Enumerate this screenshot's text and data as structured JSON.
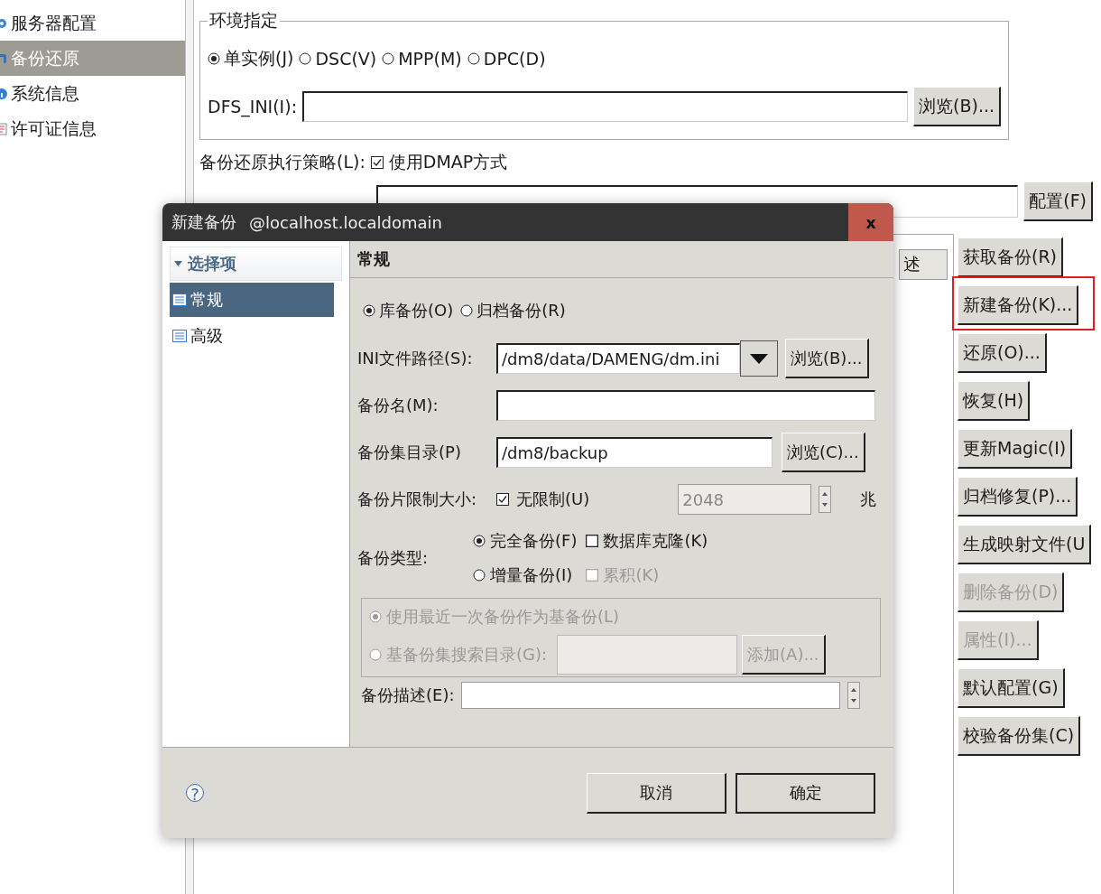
{
  "sidebar": {
    "items": [
      {
        "label": "服务器配置",
        "kind": "gear",
        "selected": false
      },
      {
        "label": "备份还原",
        "kind": "restore",
        "selected": true
      },
      {
        "label": "系统信息",
        "kind": "info",
        "selected": false
      },
      {
        "label": "许可证信息",
        "kind": "license",
        "selected": false
      }
    ]
  },
  "environment": {
    "title": "环境指定",
    "modes": [
      {
        "label": "单实例(J)",
        "selected": true
      },
      {
        "label": "DSC(V)",
        "selected": false
      },
      {
        "label": "MPP(M)",
        "selected": false
      },
      {
        "label": "DPC(D)",
        "selected": false
      }
    ],
    "dfs_ini_label": "DFS_INI(I):",
    "browse_button": "浏览(B)..."
  },
  "strategy": {
    "label": "备份还原执行策略(L):",
    "option": {
      "label": "使用DMAP方式",
      "checked": true
    }
  },
  "search_dir": {
    "config_button": "配置(F)"
  },
  "table": {
    "column_header": "述"
  },
  "actions": [
    {
      "label": "获取备份(R)",
      "disabled": false,
      "highlighted": false
    },
    {
      "label": "新建备份(K)...",
      "disabled": false,
      "highlighted": true
    },
    {
      "label": "还原(O)...",
      "disabled": false,
      "highlighted": false
    },
    {
      "label": "恢复(H)",
      "disabled": false,
      "highlighted": false
    },
    {
      "label": "更新Magic(I)",
      "disabled": false,
      "highlighted": false
    },
    {
      "label": "归档修复(P)...",
      "disabled": false,
      "highlighted": false
    },
    {
      "label": "生成映射文件(U",
      "disabled": false,
      "highlighted": false
    },
    {
      "label": "删除备份(D)",
      "disabled": true,
      "highlighted": false
    },
    {
      "label": "属性(I)...",
      "disabled": true,
      "highlighted": false
    },
    {
      "label": "默认配置(G)",
      "disabled": false,
      "highlighted": false
    },
    {
      "label": "校验备份集(C)",
      "disabled": false,
      "highlighted": false
    }
  ],
  "dialog": {
    "title": "新建备份",
    "host": "@localhost.localdomain",
    "close": "x",
    "nav": {
      "header": "选择项",
      "items": [
        {
          "label": "常规",
          "selected": true
        },
        {
          "label": "高级",
          "selected": false
        }
      ]
    },
    "section_title": "常规",
    "backup_modes": [
      {
        "label": "库备份(O)",
        "selected": true
      },
      {
        "label": "归档备份(R)",
        "selected": false
      }
    ],
    "ini_path": {
      "label": "INI文件路径(S):",
      "value": "/dm8/data/DAMENG/dm.ini",
      "browse_button": "浏览(B)..."
    },
    "backup_name": {
      "label": "备份名(M):"
    },
    "backup_dir": {
      "label": "备份集目录(P)",
      "value": "/dm8/backup",
      "browse_button": "浏览(C)..."
    },
    "piece_limit": {
      "label": "备份片限制大小:",
      "unlimited": {
        "label": "无限制(U)",
        "checked": true
      },
      "size": "2048",
      "unit": "兆"
    },
    "backup_type": {
      "label": "备份类型:",
      "options": [
        {
          "kind": "radio",
          "label": "完全备份(F)",
          "selected": true,
          "disabled": false
        },
        {
          "kind": "checkbox",
          "label": "数据库克隆(K)",
          "checked": false,
          "disabled": false
        },
        {
          "kind": "radio",
          "label": "增量备份(I)",
          "selected": false,
          "disabled": false
        },
        {
          "kind": "checkbox",
          "label": "累积(K)",
          "checked": false,
          "disabled": true
        }
      ]
    },
    "base_backup": {
      "disabled": true,
      "options": [
        {
          "label": "使用最近一次备份作为基备份(L)",
          "selected": true
        },
        {
          "label": "基备份集搜索目录(G):",
          "selected": false
        }
      ],
      "add_button": "添加(A)..."
    },
    "description": {
      "label": "备份描述(E):"
    },
    "help": "?",
    "buttons": [
      "取消",
      "确定"
    ]
  }
}
